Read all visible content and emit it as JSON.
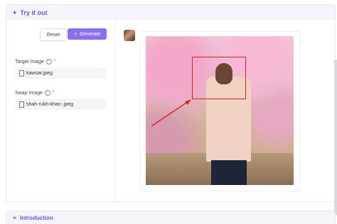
{
  "header": {
    "icon": "sparkle-icon",
    "title": "Try it out"
  },
  "toolbar": {
    "reset_label": "Reset",
    "generate_icon": "magic-wand-icon",
    "generate_label": "Generate"
  },
  "target_image": {
    "label": "Target Image",
    "required_mark": "*",
    "filename": "kawsar.jpeg"
  },
  "swap_image": {
    "label": "Swap Image",
    "required_mark": "*",
    "filename": "shah-rukh-khan-.jpeg"
  },
  "result": {
    "avatar_icon": "avatar-thumbnail",
    "image_icon": "result-photo"
  },
  "introduction": {
    "icon": "lightbulb-icon",
    "title": "Introduction"
  },
  "colors": {
    "accent": "#8b6fe8",
    "header_text": "#6d55d6",
    "highlight_box": "#e02020"
  }
}
